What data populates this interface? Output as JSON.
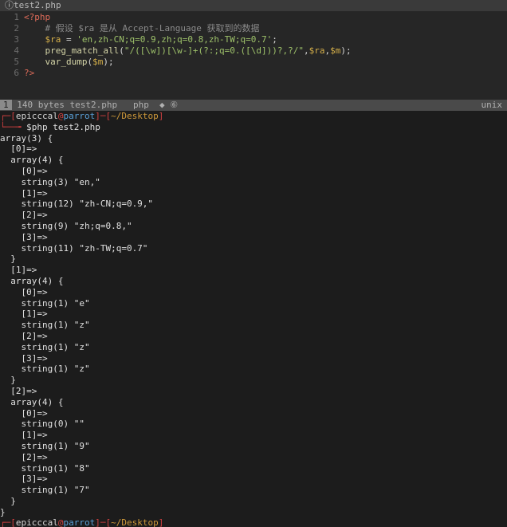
{
  "vim": {
    "tab": {
      "icon": "ⓘ",
      "title": "test2.php"
    },
    "lines": [
      {
        "num": "1",
        "parts": [
          {
            "cls": "php-tag",
            "text": "<?php"
          }
        ]
      },
      {
        "num": "2",
        "parts": [
          {
            "cls": "code",
            "text": "    "
          },
          {
            "cls": "php-comment",
            "text": "# 假设 $ra 是从 Accept-Language 获取到的数据"
          }
        ]
      },
      {
        "num": "3",
        "parts": [
          {
            "cls": "code",
            "text": "    "
          },
          {
            "cls": "php-var",
            "text": "$ra"
          },
          {
            "cls": "code",
            "text": " = "
          },
          {
            "cls": "php-str",
            "text": "'en,zh-CN;q=0.9,zh;q=0.8,zh-TW;q=0.7'"
          },
          {
            "cls": "code",
            "text": ";"
          }
        ]
      },
      {
        "num": "4",
        "parts": [
          {
            "cls": "code",
            "text": "    "
          },
          {
            "cls": "php-fn",
            "text": "preg_match_all"
          },
          {
            "cls": "code",
            "text": "("
          },
          {
            "cls": "php-str",
            "text": "\"/([\\w])[\\w-]+(?:;q=0.([\\d]))?,?/\""
          },
          {
            "cls": "code",
            "text": ","
          },
          {
            "cls": "php-var",
            "text": "$ra"
          },
          {
            "cls": "code",
            "text": ","
          },
          {
            "cls": "php-var",
            "text": "$m"
          },
          {
            "cls": "code",
            "text": ");"
          }
        ]
      },
      {
        "num": "5",
        "parts": [
          {
            "cls": "code",
            "text": "    "
          },
          {
            "cls": "php-fn",
            "text": "var_dump"
          },
          {
            "cls": "code",
            "text": "("
          },
          {
            "cls": "php-var",
            "text": "$m"
          },
          {
            "cls": "code",
            "text": ");"
          }
        ]
      },
      {
        "num": "6",
        "parts": [
          {
            "cls": "php-tag",
            "text": "?>"
          }
        ]
      }
    ],
    "status": {
      "mode_num": "1",
      "left": " 140 bytes test2.php   php  ◆ ⑥",
      "right": "unix"
    }
  },
  "terminal": {
    "prompt1": {
      "corner_top": "┌─[",
      "user": "epicccal",
      "at": "@",
      "host": "parrot",
      "sep": "]─[",
      "path": "~/Desktop",
      "end": "]"
    },
    "prompt1_cmd": {
      "corner_bottom": "└──╼ ",
      "cmd": "$php test2.php"
    },
    "output": [
      "array(3) {",
      "  [0]=>",
      "  array(4) {",
      "    [0]=>",
      "    string(3) \"en,\"",
      "    [1]=>",
      "    string(12) \"zh-CN;q=0.9,\"",
      "    [2]=>",
      "    string(9) \"zh;q=0.8,\"",
      "    [3]=>",
      "    string(11) \"zh-TW;q=0.7\"",
      "  }",
      "  [1]=>",
      "  array(4) {",
      "    [0]=>",
      "    string(1) \"e\"",
      "    [1]=>",
      "    string(1) \"z\"",
      "    [2]=>",
      "    string(1) \"z\"",
      "    [3]=>",
      "    string(1) \"z\"",
      "  }",
      "  [2]=>",
      "  array(4) {",
      "    [0]=>",
      "    string(0) \"\"",
      "    [1]=>",
      "    string(1) \"9\"",
      "    [2]=>",
      "    string(1) \"8\"",
      "    [3]=>",
      "    string(1) \"7\"",
      "  }",
      "}"
    ],
    "prompt2": {
      "corner_top": "┌─[",
      "user": "epicccal",
      "at": "@",
      "host": "parrot",
      "sep": "]─[",
      "path": "~/Desktop",
      "end": "]"
    }
  }
}
